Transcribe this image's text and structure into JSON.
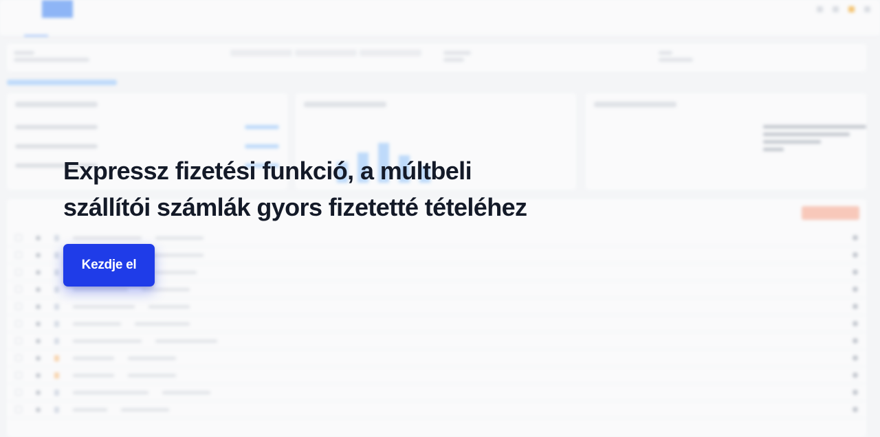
{
  "overlay": {
    "headline_line1": "Expressz fizetési funkció, a múltbeli",
    "headline_line2": "szállítói számlák gyors fizetetté tételéhez",
    "cta_label": "Kezdje el",
    "cta_color": "#1f3ce8"
  },
  "colors": {
    "accent": "#3b82f6",
    "headline": "#141a28",
    "background": "#f4f5f7",
    "warning": "#f59e0b"
  }
}
